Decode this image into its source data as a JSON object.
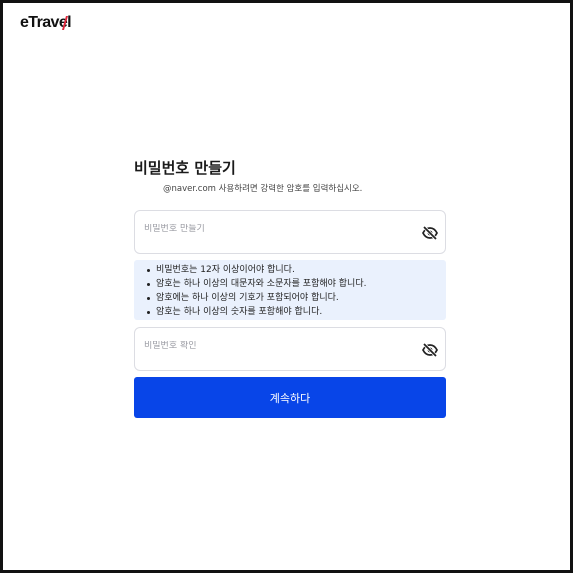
{
  "brand": {
    "logo_text": "eTravel",
    "accent_color": "#0845e8",
    "swoosh_colors": [
      "#e0263c",
      "#1b3fa8"
    ]
  },
  "form": {
    "title": "비밀번호 만들기",
    "subtitle": "@naver.com 사용하려면 강력한 암호를 입력하십시오.",
    "password_placeholder": "비밀번호 만들기",
    "confirm_placeholder": "비밀번호 확인",
    "toggle_icon": "eye-slash-icon",
    "rules": [
      "비밀번호는 12자 이상이어야 합니다.",
      "암호는 하나 이상의 대문자와 소문자를 포함해야 합니다.",
      "암호에는 하나 이상의 기호가 포함되어야 합니다.",
      "암호는 하나 이상의 숫자를 포함해야 합니다."
    ],
    "continue_label": "계속하다"
  }
}
